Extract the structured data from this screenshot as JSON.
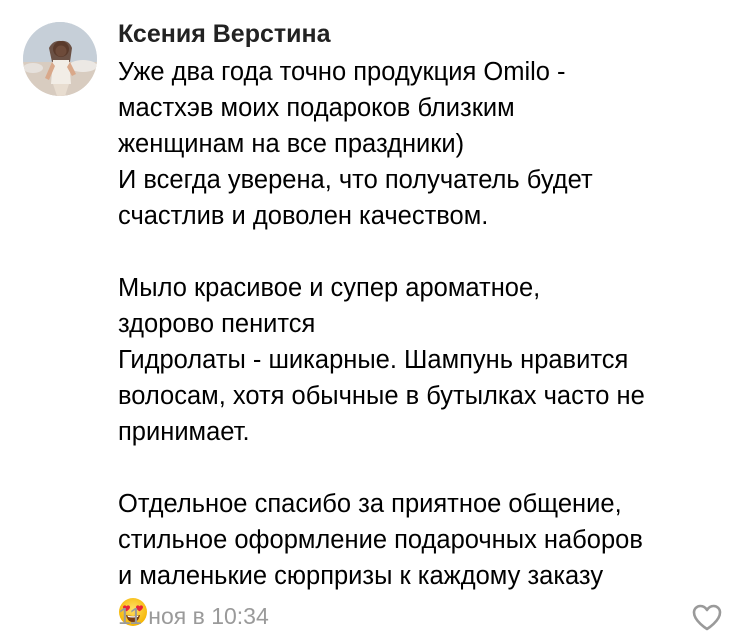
{
  "comment": {
    "author": "Ксения Верстина",
    "paragraphs": [
      {
        "lines": [
          "Уже два года точно продукция Omilo -",
          "мастхэв моих подароков близким",
          "женщинам на все праздники)",
          "И всегда уверена, что получатель будет",
          "счастлив и доволен качеством."
        ]
      },
      {
        "lines": [
          "Мыло красивое и супер ароматное,",
          "здорово пенится",
          "Гидролаты - шикарные. Шампунь нравится",
          "волосам, хотя обычные в бутылках часто не",
          "принимает."
        ]
      },
      {
        "lines": [
          "Отдельное спасибо за приятное общение,",
          "стильное оформление подарочных наборов",
          "и маленькие сюрпризы к каждому заказу"
        ],
        "emoji": "heart-eyes-emoji"
      }
    ],
    "timestamp": "11 ноя в 10:34",
    "like_icon": "heart-outline-icon"
  },
  "colors": {
    "text": "#000000",
    "author": "#222222",
    "timestamp": "#9a9a9a",
    "like_icon": "#9a9a9a",
    "background": "#ffffff"
  }
}
